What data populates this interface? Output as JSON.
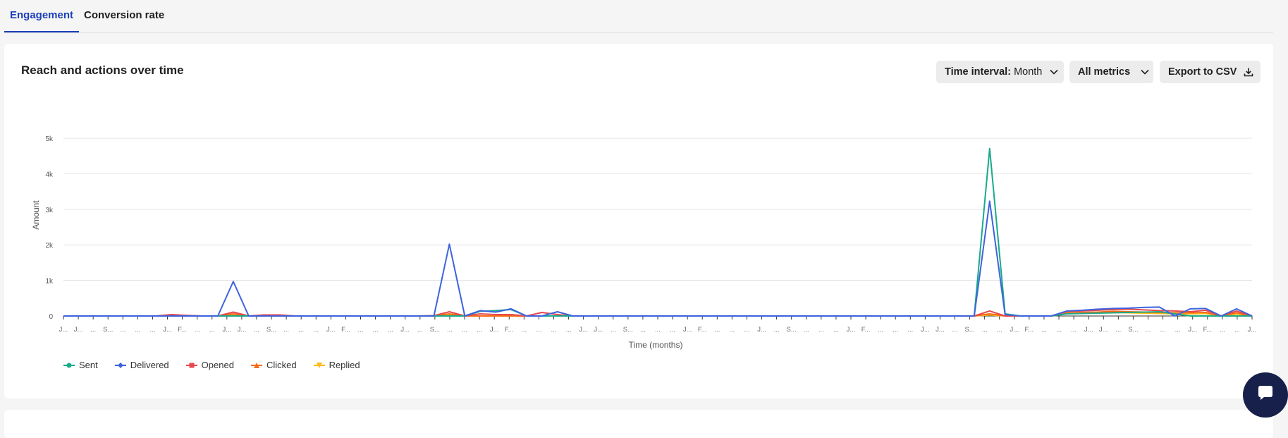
{
  "tabs": [
    {
      "label": "Engagement",
      "active": true
    },
    {
      "label": "Conversion rate",
      "active": false
    }
  ],
  "card": {
    "title": "Reach and actions over time",
    "interval_label": "Time interval:",
    "interval_value": "Month",
    "metrics_label": "All metrics",
    "export_label": "Export to CSV"
  },
  "icons": {
    "chevron": "chevron-down-icon",
    "download": "download-icon",
    "chat": "chat-icon"
  },
  "chart_data": {
    "type": "line",
    "title": "",
    "xlabel": "Time (months)",
    "ylabel": "Amount",
    "ylim": [
      0,
      5000
    ],
    "y_ticks": [
      "0",
      "1k",
      "2k",
      "3k",
      "4k",
      "5k"
    ],
    "grid": true,
    "legend_position": "bottom-left",
    "x_tick_labels": [
      "J...",
      "J...",
      "...",
      "S...",
      "...",
      "...",
      "...",
      "J...",
      "F...",
      "...",
      "...",
      "J...",
      "J...",
      "...",
      "S...",
      "...",
      "...",
      "...",
      "J...",
      "F...",
      "...",
      "...",
      "...",
      "J...",
      "...",
      "S...",
      "...",
      "...",
      "...",
      "J...",
      "F...",
      "...",
      "...",
      "...",
      "...",
      "J...",
      "J...",
      "...",
      "S...",
      "...",
      "...",
      "...",
      "J...",
      "F...",
      "...",
      "...",
      "...",
      "J...",
      "...",
      "S...",
      "...",
      "...",
      "...",
      "J...",
      "F...",
      "...",
      "...",
      "...",
      "J...",
      "J...",
      "...",
      "S...",
      "...",
      "...",
      "J...",
      "F...",
      "...",
      "...",
      "...",
      "J...",
      "J...",
      "...",
      "S...",
      "...",
      "...",
      "...",
      "J...",
      "F...",
      "...",
      "...",
      "J..."
    ],
    "series": [
      {
        "name": "Sent",
        "color": "#1aaa8a",
        "marker": "circle",
        "values": [
          0,
          0,
          0,
          0,
          0,
          0,
          0,
          0,
          0,
          0,
          0,
          0,
          0,
          0,
          0,
          0,
          0,
          0,
          0,
          0,
          0,
          0,
          0,
          0,
          0,
          0,
          0,
          0,
          0,
          0,
          0,
          0,
          0,
          0,
          0,
          0,
          0,
          0,
          0,
          0,
          0,
          0,
          0,
          0,
          0,
          0,
          0,
          0,
          0,
          0,
          0,
          0,
          0,
          0,
          0,
          0,
          0,
          0,
          0,
          0,
          0,
          0,
          0,
          0,
          0,
          0,
          0,
          0,
          0,
          0,
          0,
          0,
          0,
          0,
          0,
          0,
          0,
          0,
          0,
          0,
          0,
          0,
          0,
          0,
          0,
          0,
          0,
          0,
          0,
          0,
          0,
          0,
          0,
          0,
          0,
          0,
          0,
          0,
          0,
          0,
          0,
          0,
          0,
          0,
          0,
          0,
          0,
          0,
          0,
          0,
          0,
          0,
          0,
          0,
          0,
          0,
          0,
          0,
          0,
          0,
          0,
          0,
          0,
          0,
          0,
          0,
          0,
          0,
          0,
          0,
          0,
          0,
          0,
          0,
          0,
          0,
          0,
          0,
          0,
          0,
          0,
          0,
          0,
          0,
          0,
          0,
          0,
          0,
          0,
          0,
          0,
          0,
          0,
          0
        ]
      },
      {
        "name": "Delivered",
        "color": "#3d63dd",
        "marker": "diamond",
        "values": []
      },
      {
        "name": "Opened",
        "color": "#e5484d",
        "marker": "square",
        "values": []
      },
      {
        "name": "Clicked",
        "color": "#f76b15",
        "marker": "triangle",
        "values": []
      },
      {
        "name": "Replied",
        "color": "#ffba18",
        "marker": "triangle-down",
        "values": []
      }
    ]
  }
}
